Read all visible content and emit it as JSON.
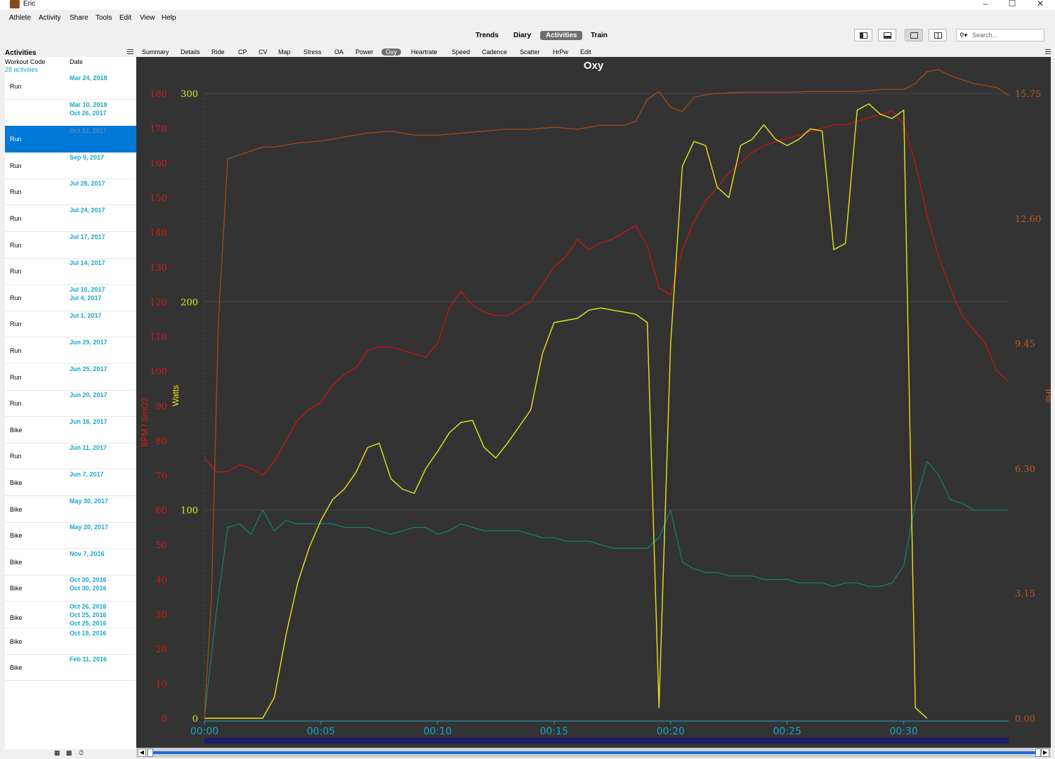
{
  "window": {
    "title": "Eric"
  },
  "menu": [
    "Athlete",
    "Activity",
    "Share",
    "Tools",
    "Edit",
    "View",
    "Help"
  ],
  "view_tabs": [
    {
      "label": "Trends",
      "active": false
    },
    {
      "label": "Diary",
      "active": false
    },
    {
      "label": "Activities",
      "active": true
    },
    {
      "label": "Train",
      "active": false
    }
  ],
  "search": {
    "placeholder": "Search..."
  },
  "sidebar": {
    "title": "Activities",
    "col_workout": "Workout Code",
    "col_date": "Date",
    "count": "28 activities",
    "rows": [
      {
        "date": "Mar 24, 2018",
        "type": "Run",
        "selected": false
      },
      {
        "date": "Mar 10, 2018",
        "extra": [
          "Oct 26, 2017"
        ],
        "type": "",
        "selected": false
      },
      {
        "date": "Oct 22, 2017",
        "type": "Run",
        "selected": true
      },
      {
        "date": "Sep 9, 2017",
        "type": "Run",
        "selected": false
      },
      {
        "date": "Jul 28, 2017",
        "type": "Run",
        "selected": false
      },
      {
        "date": "Jul 24, 2017",
        "type": "Run",
        "selected": false
      },
      {
        "date": "Jul 17, 2017",
        "type": "Run",
        "selected": false
      },
      {
        "date": "Jul 14, 2017",
        "type": "Run",
        "selected": false
      },
      {
        "date": "Jul 10, 2017",
        "extra": [
          "Jul 4, 2017"
        ],
        "type": "Run",
        "selected": false
      },
      {
        "date": "Jul 1, 2017",
        "type": "Run",
        "selected": false
      },
      {
        "date": "Jun 29, 2017",
        "type": "Run",
        "selected": false
      },
      {
        "date": "Jun 25, 2017",
        "type": "Run",
        "selected": false
      },
      {
        "date": "Jun 20, 2017",
        "type": "Run",
        "selected": false
      },
      {
        "date": "Jun 16, 2017",
        "type": "Bike",
        "selected": false
      },
      {
        "date": "Jun 11, 2017",
        "type": "Run",
        "selected": false
      },
      {
        "date": "Jun 7, 2017",
        "type": "Bike",
        "selected": false
      },
      {
        "date": "May 30, 2017",
        "type": "Bike",
        "selected": false
      },
      {
        "date": "May 20, 2017",
        "type": "Bike",
        "selected": false
      },
      {
        "date": "Nov 7, 2016",
        "type": "Bike",
        "selected": false
      },
      {
        "date": "Oct 30, 2016",
        "extra": [
          "Oct 30, 2016"
        ],
        "type": "Bike",
        "selected": false
      },
      {
        "date": "Oct 26, 2016",
        "extra": [
          "Oct 25, 2016",
          "Oct 25, 2016"
        ],
        "type": "Bike",
        "selected": false
      },
      {
        "date": "Oct 19, 2016",
        "type": "Bike",
        "selected": false
      },
      {
        "date": "Feb 11, 2016",
        "type": "Bike",
        "selected": false
      }
    ]
  },
  "chart_tabs": [
    {
      "label": "Summary",
      "active": false
    },
    {
      "label": "Details",
      "active": false
    },
    {
      "label": "Ride",
      "active": false
    },
    {
      "label": "CP",
      "active": false
    },
    {
      "label": "CV",
      "active": false
    },
    {
      "label": "Map",
      "active": false
    },
    {
      "label": "Stress",
      "active": false
    },
    {
      "label": "OA",
      "active": false
    },
    {
      "label": "Power",
      "active": false
    },
    {
      "label": "Oxy",
      "active": true
    },
    {
      "label": "Heartrate",
      "active": false
    },
    {
      "label": "Speed",
      "active": false
    },
    {
      "label": "Cadence",
      "active": false
    },
    {
      "label": "Scatter",
      "active": false
    },
    {
      "label": "HrPw",
      "active": false
    },
    {
      "label": "Edit",
      "active": false
    }
  ],
  "colors": {
    "heartrate": "#c41414",
    "watts": "#e6e61e",
    "smo2": "#167a6e",
    "thb": "#9c4a1a",
    "axis_left": "#d41c1c",
    "axis_watts": "#e6e61e",
    "axis_right": "#c05a1a",
    "time_axis": "#1aa7c9"
  },
  "chart_data": {
    "type": "line",
    "title": "Oxy",
    "x_ticks": [
      "00:00",
      "00:05",
      "00:10",
      "00:15",
      "00:20",
      "00:25",
      "00:30"
    ],
    "xlim": [
      0,
      34.5
    ],
    "axes": {
      "left": {
        "label": "BPM / SmO2",
        "ticks": [
          0,
          10,
          20,
          30,
          40,
          50,
          60,
          70,
          80,
          90,
          100,
          110,
          120,
          130,
          140,
          150,
          160,
          170,
          180
        ],
        "ylim": [
          0,
          180
        ]
      },
      "watts": {
        "label": "Watts",
        "ticks": [
          0,
          100,
          200,
          300
        ],
        "ylim": [
          0,
          300
        ]
      },
      "right": {
        "label": "tHb",
        "ticks": [
          "0.00",
          "3.15",
          "6.30",
          "9.45",
          "12.60",
          "15.75"
        ],
        "ylim": [
          0,
          15.75
        ]
      }
    },
    "series": [
      {
        "key": "heartrate",
        "axis": "left",
        "x": [
          0,
          0.5,
          1,
          1.5,
          2,
          2.5,
          3,
          3.5,
          4,
          4.5,
          5,
          5.5,
          6,
          6.5,
          7,
          7.5,
          8,
          8.5,
          9,
          9.5,
          10,
          10.5,
          11,
          11.5,
          12,
          12.5,
          13,
          13.5,
          14,
          14.5,
          15,
          15.5,
          16,
          16.5,
          17,
          17.5,
          18,
          18.5,
          19,
          19.5,
          20,
          20.5,
          21,
          21.5,
          22,
          22.5,
          23,
          23.5,
          24,
          24.5,
          25,
          25.5,
          26,
          26.5,
          27,
          27.5,
          28,
          28.5,
          29,
          29.5,
          30,
          30.5,
          31,
          31.5,
          32,
          32.5,
          33,
          33.5,
          34,
          34.5
        ],
        "y": [
          75,
          71,
          71,
          73,
          72,
          70,
          74,
          80,
          86,
          89,
          91,
          96,
          99,
          101,
          106,
          107,
          107,
          106,
          105,
          104,
          108,
          118,
          123,
          119,
          117,
          116,
          116,
          118,
          120,
          125,
          130,
          133,
          138,
          135,
          137,
          138,
          140,
          142,
          136,
          124,
          122,
          135,
          143,
          149,
          153,
          157,
          160,
          163,
          165,
          166,
          167,
          168,
          169,
          170,
          171,
          171,
          172,
          173,
          174,
          175,
          171,
          160,
          145,
          133,
          124,
          116,
          112,
          108,
          100,
          97
        ]
      },
      {
        "key": "smo2",
        "axis": "left",
        "x": [
          0,
          0.5,
          1,
          1.5,
          2,
          2.5,
          3,
          3.5,
          4,
          4.5,
          5,
          5.5,
          6,
          6.5,
          7,
          7.5,
          8,
          8.5,
          9,
          9.5,
          10,
          10.5,
          11,
          11.5,
          12,
          12.5,
          13,
          13.5,
          14,
          14.5,
          15,
          15.5,
          16,
          16.5,
          17,
          17.5,
          18,
          18.5,
          19,
          19.5,
          20,
          20.5,
          21,
          21.5,
          22,
          22.5,
          23,
          23.5,
          24,
          24.5,
          25,
          25.5,
          26,
          26.5,
          27,
          27.5,
          28,
          28.5,
          29,
          29.5,
          30,
          30.5,
          31,
          31.5,
          32,
          32.5,
          33,
          33.5,
          34,
          34.5
        ],
        "y": [
          0,
          30,
          55,
          56,
          53,
          60,
          54,
          57,
          56,
          56,
          56,
          56,
          55,
          55,
          55,
          54,
          53,
          54,
          55,
          55,
          53,
          54,
          56,
          55,
          54,
          54,
          54,
          54,
          53,
          52,
          52,
          51,
          51,
          51,
          50,
          49,
          49,
          49,
          49,
          52,
          60,
          45,
          43,
          42,
          42,
          41,
          41,
          41,
          40,
          40,
          40,
          39,
          39,
          39,
          38,
          39,
          39,
          38,
          38,
          39,
          44,
          62,
          74,
          70,
          63,
          62,
          60,
          60,
          60,
          60
        ]
      },
      {
        "key": "watts",
        "axis": "watts",
        "x": [
          0,
          0.5,
          1,
          1.5,
          2,
          2.5,
          3,
          3.5,
          4,
          4.5,
          5,
          5.5,
          6,
          6.5,
          7,
          7.5,
          8,
          8.5,
          9,
          9.5,
          10,
          10.5,
          11,
          11.5,
          12,
          12.5,
          13,
          13.5,
          14,
          14.5,
          15,
          15.5,
          16,
          16.5,
          17,
          17.5,
          18,
          18.5,
          19,
          19.5,
          20,
          20.5,
          21,
          21.5,
          22,
          22.5,
          23,
          23.5,
          24,
          24.5,
          25,
          25.5,
          26,
          26.5,
          27,
          27.5,
          28,
          28.5,
          29,
          29.5,
          30,
          30.5,
          31
        ],
        "y": [
          0,
          0,
          0,
          0,
          0,
          0,
          10,
          40,
          65,
          82,
          95,
          105,
          110,
          118,
          130,
          132,
          115,
          110,
          108,
          120,
          128,
          137,
          142,
          143,
          130,
          125,
          132,
          140,
          148,
          175,
          190,
          191,
          192,
          196,
          197,
          196,
          195,
          194,
          190,
          5,
          180,
          265,
          277,
          275,
          255,
          250,
          275,
          278,
          285,
          278,
          275,
          278,
          283,
          282,
          225,
          228,
          292,
          295,
          290,
          288,
          292,
          5,
          0
        ]
      },
      {
        "key": "thb",
        "axis": "right",
        "x": [
          0,
          0.3,
          0.6,
          1,
          1.5,
          2,
          2.5,
          3,
          4,
          5,
          6,
          7,
          8,
          9,
          10,
          11,
          12,
          13,
          14,
          15,
          16,
          17,
          18,
          18.5,
          19,
          19.5,
          20,
          20.5,
          21,
          21.5,
          22,
          23,
          24,
          25,
          26,
          27,
          28,
          29,
          30,
          30.5,
          31,
          31.5,
          32,
          33,
          34,
          34.5
        ],
        "y": [
          0,
          3,
          10,
          14.1,
          14.2,
          14.3,
          14.4,
          14.4,
          14.5,
          14.55,
          14.65,
          14.75,
          14.8,
          14.7,
          14.7,
          14.75,
          14.8,
          14.85,
          14.85,
          14.9,
          14.85,
          14.95,
          14.95,
          15.05,
          15.6,
          15.8,
          15.4,
          15.3,
          15.65,
          15.72,
          15.75,
          15.78,
          15.78,
          15.78,
          15.8,
          15.8,
          15.8,
          15.85,
          15.85,
          16,
          16.3,
          16.35,
          16.2,
          16,
          15.9,
          15.7
        ]
      }
    ]
  },
  "footer_icons": [
    "calendar-icon",
    "folder-icon",
    "timer-icon"
  ]
}
